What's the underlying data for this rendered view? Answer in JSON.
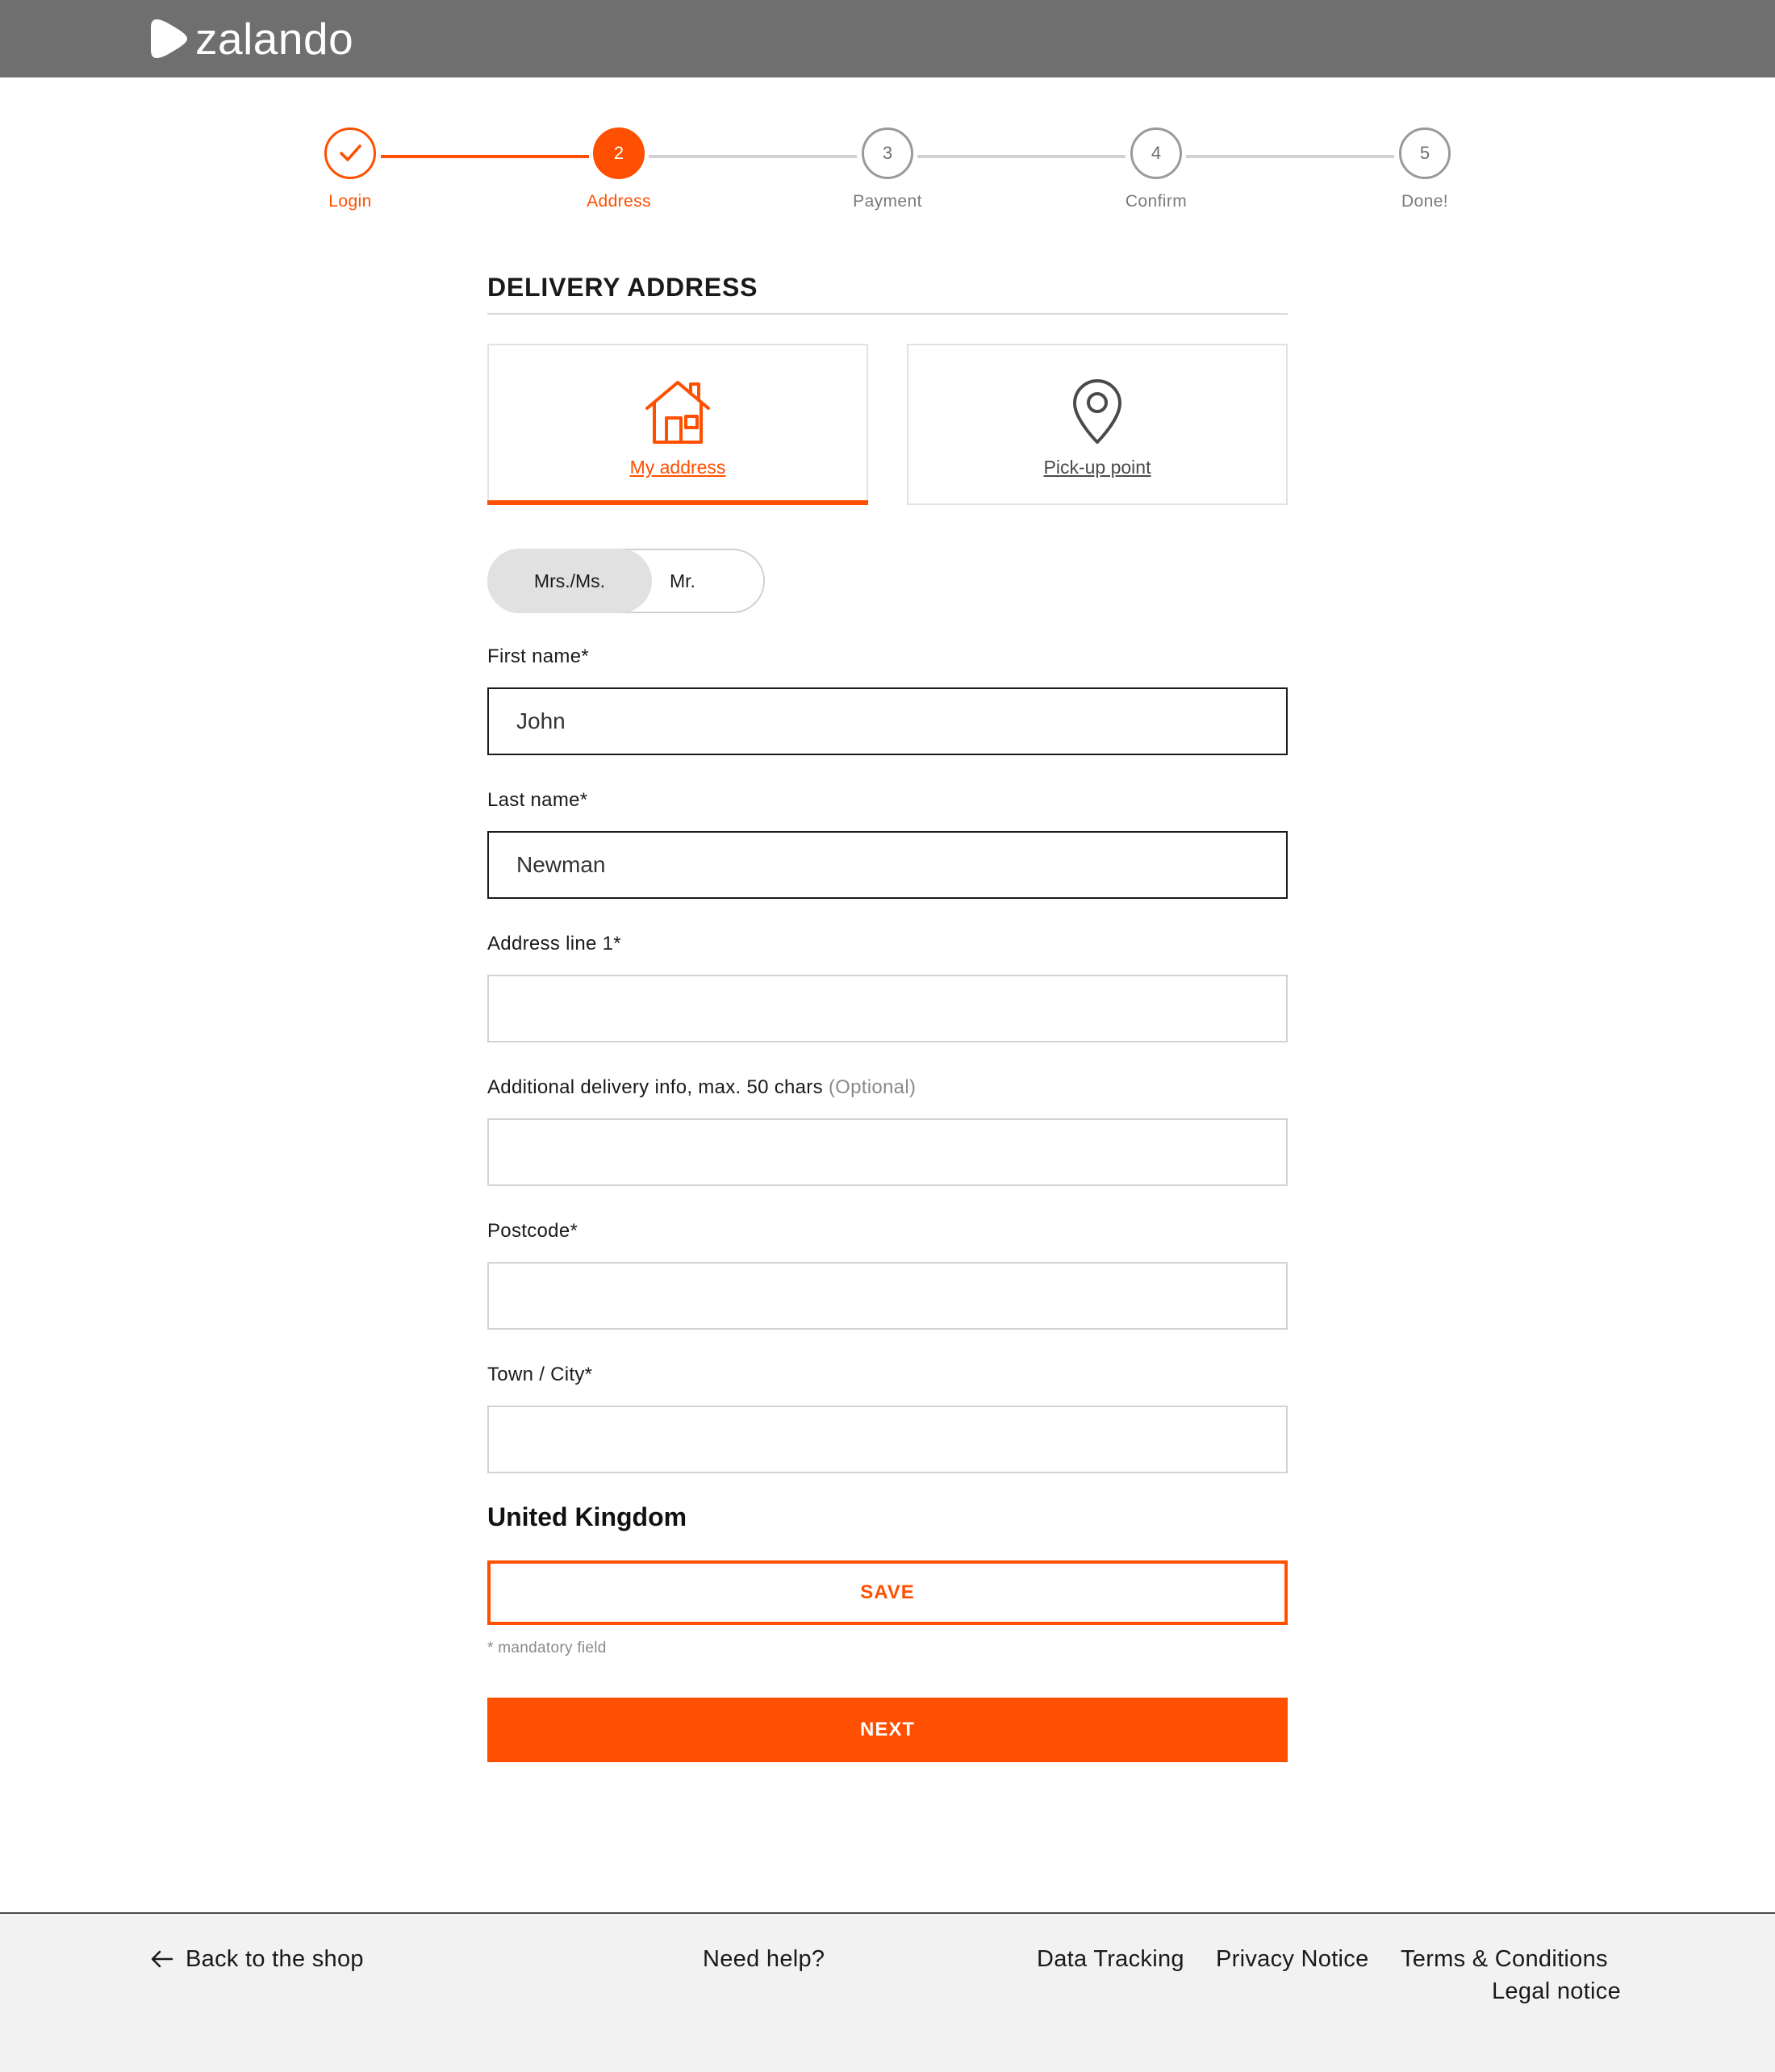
{
  "header": {
    "logo_icon": "zalando-play-icon",
    "logo_text": "zalando"
  },
  "stepper": {
    "steps": [
      {
        "label": "Login",
        "status": "done",
        "icon": "checkmark-icon"
      },
      {
        "label": "Address",
        "number": "2",
        "status": "active"
      },
      {
        "label": "Payment",
        "number": "3",
        "status": "pending"
      },
      {
        "label": "Confirm",
        "number": "4",
        "status": "pending"
      },
      {
        "label": "Done!",
        "number": "5",
        "status": "pending"
      }
    ]
  },
  "form": {
    "title": "DELIVERY ADDRESS",
    "address_types": [
      {
        "label": "My address",
        "icon": "house-icon",
        "selected": true
      },
      {
        "label": "Pick-up point",
        "icon": "location-pin-icon",
        "selected": false
      }
    ],
    "salutation": {
      "options": [
        "Mrs./Ms.",
        "Mr."
      ],
      "selected": "Mrs./Ms."
    },
    "fields": {
      "first_name": {
        "label": "First name*",
        "value": "John"
      },
      "last_name": {
        "label": "Last name*",
        "value": "Newman"
      },
      "address_line1": {
        "label": "Address line 1*",
        "value": ""
      },
      "additional_info": {
        "label": "Additional delivery info, max. 50 chars",
        "optional": "(Optional)",
        "value": ""
      },
      "postcode": {
        "label": "Postcode*",
        "value": ""
      },
      "city": {
        "label": "Town / City*",
        "value": ""
      }
    },
    "country": "United Kingdom",
    "save_label": "SAVE",
    "mandatory_note": "* mandatory field",
    "next_label": "NEXT"
  },
  "footer": {
    "back_label": "Back to the shop",
    "back_icon": "arrow-left-icon",
    "help": "Need help?",
    "links": {
      "data_tracking": "Data Tracking",
      "privacy": "Privacy Notice",
      "terms": "Terms & Conditions",
      "legal": "Legal notice"
    }
  },
  "colors": {
    "accent": "#ff4f00",
    "header_bg": "#6f6f6f",
    "footer_bg": "#f2f2f2"
  }
}
